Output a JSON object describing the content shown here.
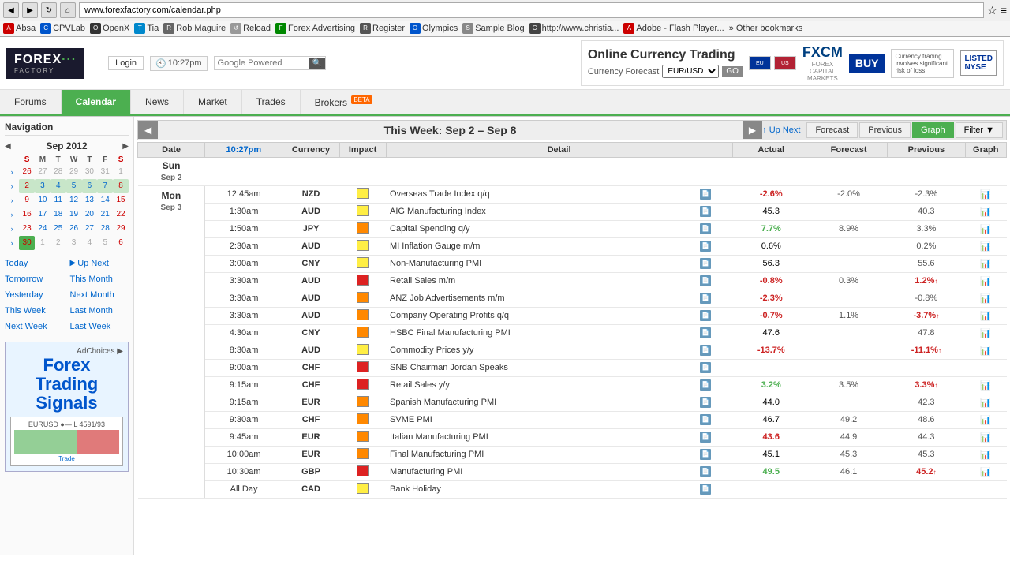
{
  "browser": {
    "address": "www.forexfactory.com/calendar.php",
    "bookmarks": [
      {
        "label": "Absa",
        "icon": "A"
      },
      {
        "label": "CPVLab",
        "icon": "C"
      },
      {
        "label": "OpenX",
        "icon": "O"
      },
      {
        "label": "Tia",
        "icon": "T"
      },
      {
        "label": "Rob Maguire",
        "icon": "R"
      },
      {
        "label": "Reload",
        "icon": "↺"
      },
      {
        "label": "Forex Advertising",
        "icon": "F"
      },
      {
        "label": "Register",
        "icon": "R"
      },
      {
        "label": "Olympics",
        "icon": "O"
      },
      {
        "label": "Sample Blog",
        "icon": "S"
      },
      {
        "label": "http://www.christia...",
        "icon": "C"
      },
      {
        "label": "Adobe - Flash Player...",
        "icon": "A"
      },
      {
        "label": "Other bookmarks",
        "icon": "»"
      }
    ]
  },
  "site": {
    "logo_top": "FOREX",
    "logo_bottom": "FACTORY",
    "login_label": "Login",
    "time": "10:27pm",
    "search_placeholder": "Google Powered",
    "ad_title": "Online Currency Trading",
    "ad_subtitle": "Currency Forecast",
    "ad_pair": "EUR/USD",
    "nav_items": [
      {
        "label": "Forums",
        "active": false
      },
      {
        "label": "Calendar",
        "active": true
      },
      {
        "label": "News",
        "active": false
      },
      {
        "label": "Market",
        "active": false
      },
      {
        "label": "Trades",
        "active": false
      },
      {
        "label": "Brokers",
        "active": false,
        "beta": true
      }
    ]
  },
  "sidebar": {
    "title": "Navigation",
    "calendar": {
      "month_year": "Sep 2012",
      "days_header": [
        "S",
        "M",
        "T",
        "W",
        "T",
        "F",
        "S"
      ],
      "weeks": [
        {
          "num": "",
          "days": [
            {
              "d": "26",
              "cls": "other-month sun"
            },
            {
              "d": "27",
              "cls": "other-month"
            },
            {
              "d": "28",
              "cls": "other-month"
            },
            {
              "d": "29",
              "cls": "other-month"
            },
            {
              "d": "30",
              "cls": "other-month"
            },
            {
              "d": "31",
              "cls": "other-month"
            },
            {
              "d": "1",
              "cls": ""
            }
          ]
        },
        {
          "num": "",
          "days": [
            {
              "d": "2",
              "cls": "highlight sun"
            },
            {
              "d": "3",
              "cls": "highlight"
            },
            {
              "d": "4",
              "cls": "highlight"
            },
            {
              "d": "5",
              "cls": "highlight"
            },
            {
              "d": "6",
              "cls": "highlight"
            },
            {
              "d": "7",
              "cls": "highlight"
            },
            {
              "d": "8",
              "cls": "highlight sat"
            }
          ]
        },
        {
          "num": "",
          "days": [
            {
              "d": "9",
              "cls": "sun"
            },
            {
              "d": "10",
              "cls": ""
            },
            {
              "d": "11",
              "cls": ""
            },
            {
              "d": "12",
              "cls": ""
            },
            {
              "d": "13",
              "cls": ""
            },
            {
              "d": "14",
              "cls": ""
            },
            {
              "d": "15",
              "cls": "sat"
            }
          ]
        },
        {
          "num": "",
          "days": [
            {
              "d": "16",
              "cls": "sun"
            },
            {
              "d": "17",
              "cls": ""
            },
            {
              "d": "18",
              "cls": ""
            },
            {
              "d": "19",
              "cls": ""
            },
            {
              "d": "20",
              "cls": ""
            },
            {
              "d": "21",
              "cls": ""
            },
            {
              "d": "22",
              "cls": "sat"
            }
          ]
        },
        {
          "num": "",
          "days": [
            {
              "d": "23",
              "cls": "sun"
            },
            {
              "d": "24",
              "cls": ""
            },
            {
              "d": "25",
              "cls": ""
            },
            {
              "d": "26",
              "cls": ""
            },
            {
              "d": "27",
              "cls": ""
            },
            {
              "d": "28",
              "cls": ""
            },
            {
              "d": "29",
              "cls": "sat"
            }
          ]
        },
        {
          "num": "",
          "days": [
            {
              "d": "30",
              "cls": "sun today"
            },
            {
              "d": "1",
              "cls": "other-month"
            },
            {
              "d": "2",
              "cls": "other-month"
            },
            {
              "d": "3",
              "cls": "other-month"
            },
            {
              "d": "4",
              "cls": "other-month"
            },
            {
              "d": "5",
              "cls": "other-month"
            },
            {
              "d": "6",
              "cls": "other-month sat"
            }
          ]
        }
      ]
    },
    "quick_links": [
      {
        "label": "Today",
        "col": 1
      },
      {
        "label": "Tomorrow",
        "col": 1
      },
      {
        "label": "Yesterday",
        "col": 1
      },
      {
        "label": "This Week",
        "col": 1
      },
      {
        "label": "Next Week",
        "col": 1
      },
      {
        "label": "Last Week",
        "col": 1
      },
      {
        "label": "Up Next",
        "col": 2
      },
      {
        "label": "This Month",
        "col": 2
      },
      {
        "label": "Next Month",
        "col": 2
      },
      {
        "label": "Last Month",
        "col": 2
      }
    ],
    "ad_label": "AdChoices",
    "ad_company": "Forex Trading Signals",
    "ad_pair_display": "EURUSD"
  },
  "calendar": {
    "prev_btn": "◀",
    "next_btn": "▶",
    "title": "This Week: Sep 2 – Sep 8",
    "up_next_label": "↑ Up Next",
    "filter_label": "Filter ▼",
    "action_btns": [
      "Forecast",
      "Previous",
      "Graph"
    ],
    "col_headers": [
      "Date",
      "10:27pm",
      "Currency",
      "Impact",
      "Detail",
      "",
      "Actual",
      "Forecast",
      "Previous",
      "Graph"
    ],
    "day_sections": [
      {
        "day_label": "Sun",
        "day_date": "Sep 2",
        "events": []
      },
      {
        "day_label": "Mon",
        "day_date": "Sep 3",
        "events": [
          {
            "time": "12:45am",
            "currency": "NZD",
            "impact": "low",
            "detail": "Overseas Trade Index q/q",
            "actual": "-2.6%",
            "actual_cls": "value-negative",
            "forecast": "-2.0%",
            "previous": "-2.3%",
            "previous_cls": "value-neutral"
          },
          {
            "time": "1:30am",
            "currency": "AUD",
            "impact": "low",
            "detail": "AIG Manufacturing Index",
            "actual": "45.3",
            "actual_cls": "value-neutral",
            "forecast": "",
            "previous": "40.3",
            "previous_cls": "value-neutral"
          },
          {
            "time": "1:50am",
            "currency": "JPY",
            "impact": "med",
            "detail": "Capital Spending q/y",
            "actual": "7.7%",
            "actual_cls": "value-positive",
            "forecast": "8.9%",
            "previous": "3.3%",
            "previous_cls": "value-neutral"
          },
          {
            "time": "2:30am",
            "currency": "AUD",
            "impact": "low",
            "detail": "MI Inflation Gauge m/m",
            "actual": "0.6%",
            "actual_cls": "value-neutral",
            "forecast": "",
            "previous": "0.2%",
            "previous_cls": "value-neutral"
          },
          {
            "time": "3:00am",
            "currency": "CNY",
            "impact": "low",
            "detail": "Non-Manufacturing PMI",
            "actual": "56.3",
            "actual_cls": "value-neutral",
            "forecast": "",
            "previous": "55.6",
            "previous_cls": "value-neutral"
          },
          {
            "time": "3:30am",
            "currency": "AUD",
            "impact": "high",
            "detail": "Retail Sales m/m",
            "actual": "-0.8%",
            "actual_cls": "value-negative",
            "forecast": "0.3%",
            "previous": "1.2%↑",
            "previous_cls": "value-negative"
          },
          {
            "time": "3:30am",
            "currency": "AUD",
            "impact": "med",
            "detail": "ANZ Job Advertisements m/m",
            "actual": "-2.3%",
            "actual_cls": "value-negative",
            "forecast": "",
            "previous": "-0.8%",
            "previous_cls": "value-neutral"
          },
          {
            "time": "3:30am",
            "currency": "AUD",
            "impact": "med",
            "detail": "Company Operating Profits q/q",
            "actual": "-0.7%",
            "actual_cls": "value-negative",
            "forecast": "1.1%",
            "previous": "-3.7%↑",
            "previous_cls": "value-negative"
          },
          {
            "time": "4:30am",
            "currency": "CNY",
            "impact": "med",
            "detail": "HSBC Final Manufacturing PMI",
            "actual": "47.6",
            "actual_cls": "value-neutral",
            "forecast": "",
            "previous": "47.8",
            "previous_cls": "value-neutral"
          },
          {
            "time": "8:30am",
            "currency": "AUD",
            "impact": "low",
            "detail": "Commodity Prices y/y",
            "actual": "-13.7%",
            "actual_cls": "value-negative",
            "forecast": "",
            "previous": "-11.1%↑",
            "previous_cls": "value-negative"
          },
          {
            "time": "9:00am",
            "currency": "CHF",
            "impact": "high",
            "detail": "SNB Chairman Jordan Speaks",
            "actual": "",
            "actual_cls": "",
            "forecast": "",
            "previous": "",
            "previous_cls": ""
          },
          {
            "time": "9:15am",
            "currency": "CHF",
            "impact": "high",
            "detail": "Retail Sales y/y",
            "actual": "3.2%",
            "actual_cls": "value-positive",
            "forecast": "3.5%",
            "previous": "3.3%↑",
            "previous_cls": "value-negative"
          },
          {
            "time": "9:15am",
            "currency": "EUR",
            "impact": "med",
            "detail": "Spanish Manufacturing PMI",
            "actual": "44.0",
            "actual_cls": "value-neutral",
            "forecast": "",
            "previous": "42.3",
            "previous_cls": "value-neutral"
          },
          {
            "time": "9:30am",
            "currency": "CHF",
            "impact": "med",
            "detail": "SVME PMI",
            "actual": "46.7",
            "actual_cls": "value-neutral",
            "forecast": "49.2",
            "previous": "48.6",
            "previous_cls": "value-neutral"
          },
          {
            "time": "9:45am",
            "currency": "EUR",
            "impact": "med",
            "detail": "Italian Manufacturing PMI",
            "actual": "43.6",
            "actual_cls": "value-negative",
            "forecast": "44.9",
            "previous": "44.3",
            "previous_cls": "value-neutral"
          },
          {
            "time": "10:00am",
            "currency": "EUR",
            "impact": "med",
            "detail": "Final Manufacturing PMI",
            "actual": "45.1",
            "actual_cls": "value-neutral",
            "forecast": "45.3",
            "previous": "45.3",
            "previous_cls": "value-neutral"
          },
          {
            "time": "10:30am",
            "currency": "GBP",
            "impact": "high",
            "detail": "Manufacturing PMI",
            "actual": "49.5",
            "actual_cls": "value-positive",
            "forecast": "46.1",
            "previous": "45.2↑",
            "previous_cls": "value-negative"
          },
          {
            "time": "All Day",
            "currency": "CAD",
            "impact": "low",
            "detail": "Bank Holiday",
            "actual": "",
            "actual_cls": "",
            "forecast": "",
            "previous": "",
            "previous_cls": ""
          }
        ]
      }
    ]
  }
}
